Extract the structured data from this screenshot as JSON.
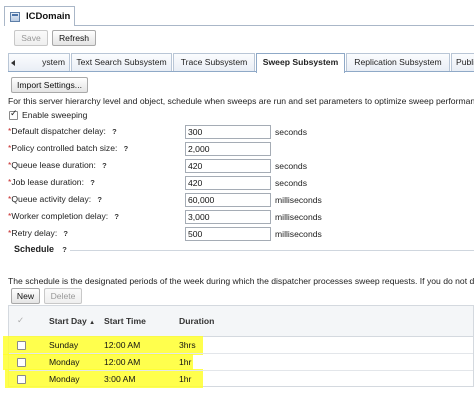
{
  "window": {
    "title": "ICDomain"
  },
  "toolbar": {
    "save_label": "Save",
    "refresh_label": "Refresh"
  },
  "tabs": [
    {
      "label": "ystem"
    },
    {
      "label": "Text Search Subsystem"
    },
    {
      "label": "Trace Subsystem"
    },
    {
      "label": "Sweep Subsystem",
      "active": true
    },
    {
      "label": "Replication Subsystem"
    },
    {
      "label": "Publi"
    }
  ],
  "import_button_label": "Import Settings...",
  "description": "For this server hierarchy level and object, schedule when sweeps are run and set parameters to optimize sweep performanc",
  "enable_sweeping": {
    "label": "Enable sweeping",
    "checked": true
  },
  "fields": [
    {
      "label": "Default dispatcher delay:",
      "value": "300",
      "unit": "seconds"
    },
    {
      "label": "Policy controlled batch size:",
      "value": "2,000",
      "unit": ""
    },
    {
      "label": "Queue lease duration:",
      "value": "420",
      "unit": "seconds"
    },
    {
      "label": "Job lease duration:",
      "value": "420",
      "unit": "seconds"
    },
    {
      "label": "Queue activity delay:",
      "value": "60,000",
      "unit": "milliseconds"
    },
    {
      "label": "Worker completion delay:",
      "value": "3,000",
      "unit": "milliseconds"
    },
    {
      "label": "Retry delay:",
      "value": "500",
      "unit": "milliseconds"
    }
  ],
  "required_marker": "*",
  "help_marker": "?",
  "schedule": {
    "title": "Schedule",
    "description": "The schedule is the designated periods of the week during which the dispatcher processes sweep requests. If you do not de",
    "new_label": "New",
    "delete_label": "Delete",
    "columns": {
      "start_day": "Start Day",
      "sort_indicator": "▲",
      "start_time": "Start Time",
      "duration": "Duration",
      "select_all": "✓"
    },
    "rows": [
      {
        "start_day": "Sunday",
        "start_time": "12:00 AM",
        "duration": "3hrs"
      },
      {
        "start_day": "Monday",
        "start_time": "12:00 AM",
        "duration": "1hr"
      },
      {
        "start_day": "Monday",
        "start_time": "3:00 AM",
        "duration": "1hr"
      }
    ]
  },
  "colors": {
    "highlight": "#ffff2e",
    "required": "#c62828",
    "tab_border": "#8fa9c7"
  }
}
